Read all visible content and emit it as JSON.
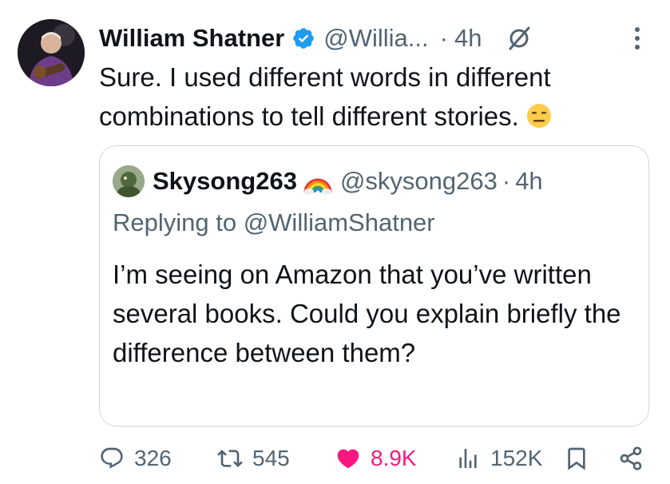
{
  "tweet": {
    "author_name": "William Shatner",
    "author_handle": "@Willia...",
    "separator": "·",
    "time": "4h",
    "text": "Sure. I used different words in different combinations to tell different stories."
  },
  "quote": {
    "author_name": "Skysong263",
    "author_handle": "@skysong263",
    "separator": "·",
    "time": "4h",
    "replying_to": "Replying to @WilliamShatner",
    "text": "I’m seeing on Amazon that you’ve written several books. Could you explain briefly the difference between them?"
  },
  "actions": {
    "replies": "326",
    "reposts": "545",
    "likes": "8.9K",
    "views": "152K"
  },
  "icons": {
    "verified": "verified-badge-icon",
    "grok": "grok-icon",
    "more": "more-icon",
    "reply": "reply-icon",
    "repost": "repost-icon",
    "like": "heart-icon",
    "views": "views-icon",
    "bookmark": "bookmark-icon",
    "share": "share-icon"
  },
  "colors": {
    "text": "#0f1419",
    "secondary": "#536471",
    "verified": "#1d9bf0",
    "like": "#f91880",
    "border": "#cfd9de"
  }
}
